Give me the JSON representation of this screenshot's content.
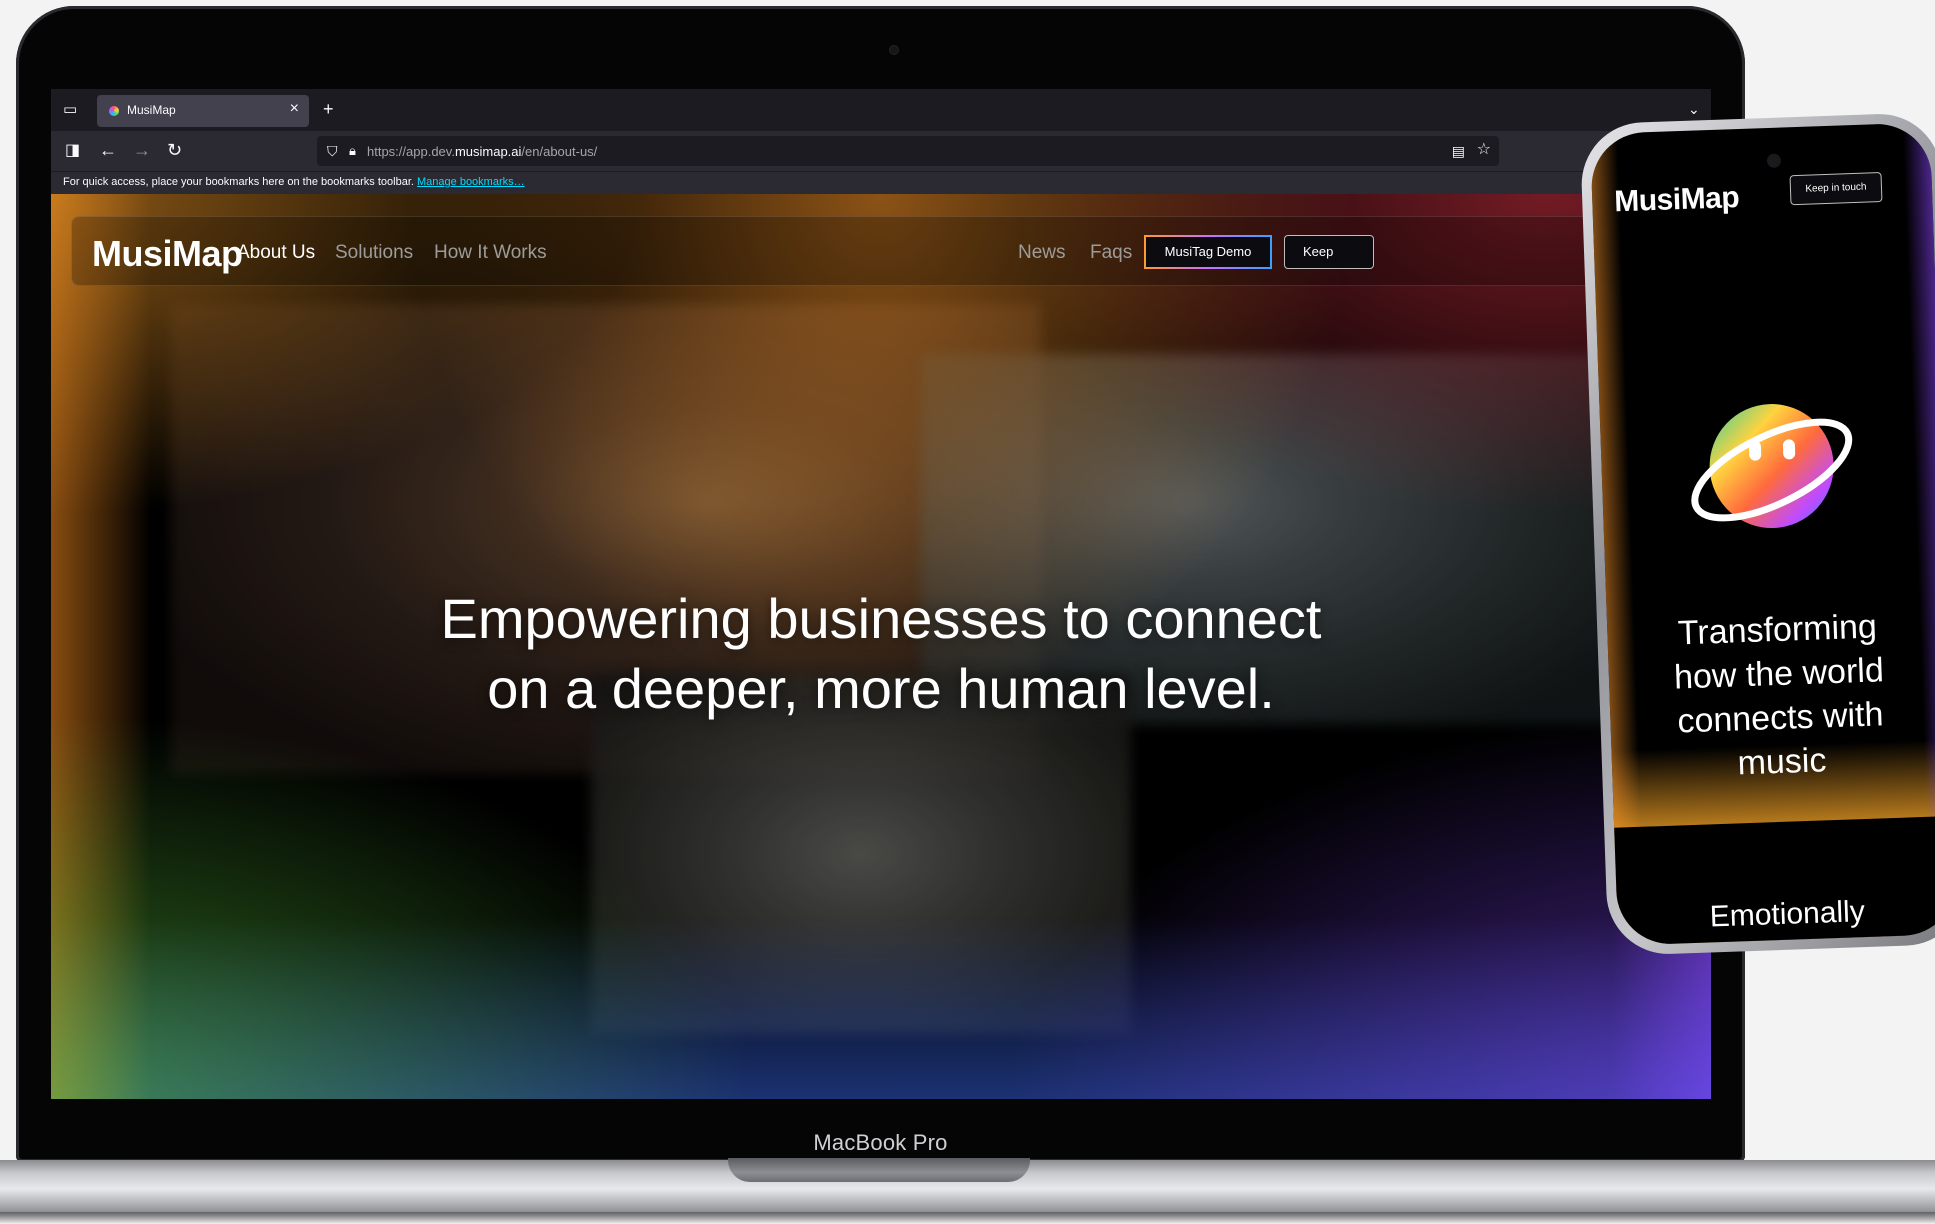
{
  "browser": {
    "tab_title": "MusiMap",
    "tab_close": "×",
    "new_tab": "+",
    "url_prefix": "https://app.dev.",
    "url_domain": "musimap.ai",
    "url_path": "/en/about-us/",
    "bookmarks_message": "For quick access, place your bookmarks here on the bookmarks toolbar.",
    "bookmarks_link": "Manage bookmarks…"
  },
  "site": {
    "logo": "MusiMap",
    "nav": {
      "about": "About Us",
      "solutions": "Solutions",
      "how": "How It Works",
      "news": "News",
      "faqs": "Faqs",
      "demo": "MusiTag Demo",
      "keep": "Keep"
    },
    "hero_line1": "Empowering businesses to connect",
    "hero_line2": "on a deeper, more human level."
  },
  "phone": {
    "logo": "MusiMap",
    "keep": "Keep in touch",
    "heading_l1": "Transforming",
    "heading_l2": "how the world",
    "heading_l3": "connects with",
    "heading_l4": "music",
    "next_line": "Emotionally"
  },
  "device_label": "MacBook Pro",
  "colors": {
    "accent_orange": "#ff9a2e",
    "accent_purple": "#c970ff",
    "accent_blue": "#3aa0ff"
  }
}
